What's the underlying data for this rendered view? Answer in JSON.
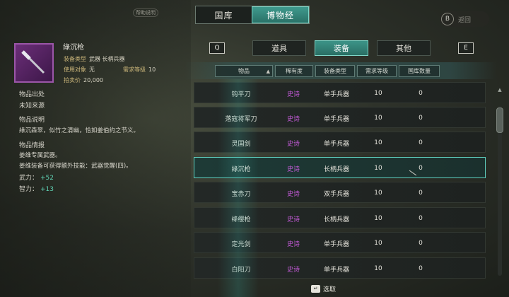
{
  "top_tabs": [
    {
      "label": "国库",
      "active": false
    },
    {
      "label": "博物经",
      "active": true
    }
  ],
  "top_left_tag": "帮助说明",
  "top_right": {
    "key": "B",
    "label": "返回"
  },
  "item": {
    "name": "綠沉枪",
    "info": [
      {
        "key": "装备类型",
        "value": "武器  长柄兵器"
      },
      {
        "key": "使用对象",
        "value": "无"
      },
      {
        "key": "需求等级",
        "value": "10"
      },
      {
        "key": "拍卖价",
        "value": "20,000"
      }
    ],
    "origin_title": "物品出处",
    "origin_text": "未知来源",
    "desc_title": "物品说明",
    "desc_text": "綠沉森翠，似竹之清幽，恰如姜伯约之节义。",
    "detail_title": "物品情报",
    "detail_lines": [
      "姜维专属武器。",
      "姜维装备可获得额外技能：武器觉醒(四)。"
    ],
    "stats": [
      {
        "label": "武力：",
        "value": "+52"
      },
      {
        "label": "智力：",
        "value": "+13"
      }
    ]
  },
  "category_tabs": [
    {
      "label": "道具",
      "active": false
    },
    {
      "label": "装备",
      "active": true
    },
    {
      "label": "其他",
      "active": false
    }
  ],
  "keys": {
    "prev": "Q",
    "next": "E"
  },
  "columns": [
    "物品",
    "稀有度",
    "装备类型",
    "需求等级",
    "国库数量"
  ],
  "rows": [
    {
      "name": "钩平刀",
      "rarity": "史诗",
      "type": "单手兵器",
      "level": "10",
      "qty": "0"
    },
    {
      "name": "落寇将军刀",
      "rarity": "史诗",
      "type": "单手兵器",
      "level": "10",
      "qty": "0"
    },
    {
      "name": "灵国剑",
      "rarity": "史诗",
      "type": "单手兵器",
      "level": "10",
      "qty": "0"
    },
    {
      "name": "綠沉枪",
      "rarity": "史诗",
      "type": "长柄兵器",
      "level": "10",
      "qty": "0"
    },
    {
      "name": "宝赤刀",
      "rarity": "史诗",
      "type": "双手兵器",
      "level": "10",
      "qty": "0"
    },
    {
      "name": "绛缨枪",
      "rarity": "史诗",
      "type": "长柄兵器",
      "level": "10",
      "qty": "0"
    },
    {
      "name": "定光剑",
      "rarity": "史诗",
      "type": "单手兵器",
      "level": "10",
      "qty": "0"
    },
    {
      "name": "白阳刀",
      "rarity": "史诗",
      "type": "单手兵器",
      "level": "10",
      "qty": "0"
    }
  ],
  "selected_row": 3,
  "bottom": {
    "key_icon": "↵",
    "label": "选取"
  },
  "colors": {
    "accent": "#3c9488",
    "rarity_epic": "#c45ad8",
    "stat_value": "#5fd0b2"
  }
}
